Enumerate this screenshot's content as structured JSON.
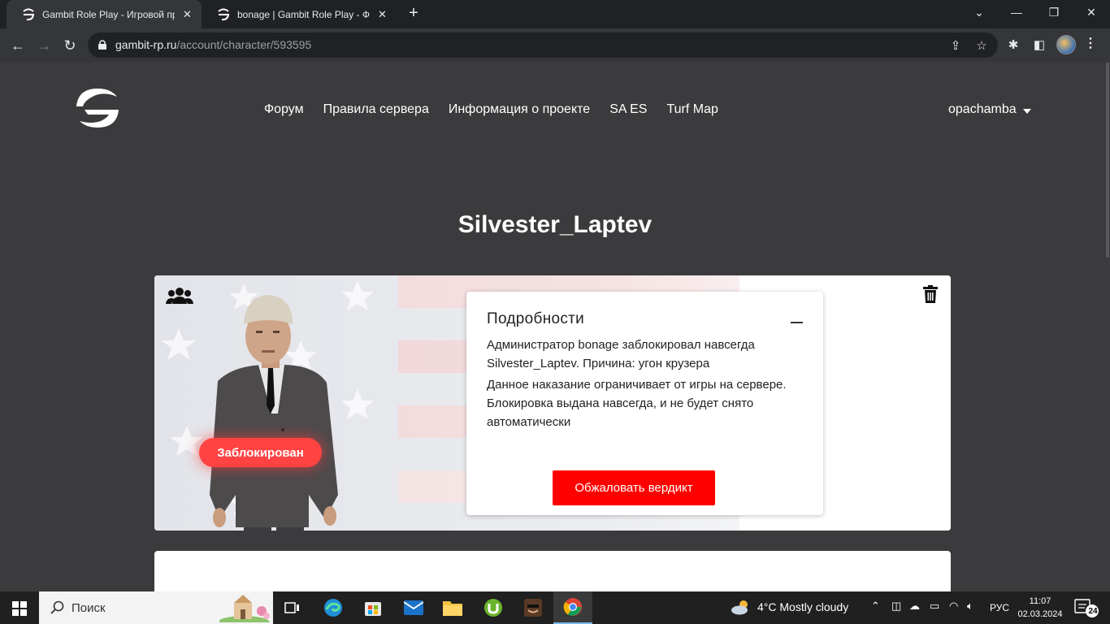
{
  "browser": {
    "tabs": [
      {
        "title": "Gambit Role Play - Игровой про",
        "active": true
      },
      {
        "title": "bonage | Gambit Role Play - Фор",
        "active": false
      }
    ],
    "url_host": "gambit-rp.ru",
    "url_path": "/account/character/593595"
  },
  "site": {
    "nav": [
      "Форум",
      "Правила сервера",
      "Информация о проекте",
      "SA ES",
      "Turf Map"
    ],
    "username": "opachamba"
  },
  "character": {
    "name": "Silvester_Laptev",
    "status_badge": "Заблокирован"
  },
  "details": {
    "title": "Подробности",
    "text1": "Администратор bonage заблокировал навсегда Silvester_Laptev. Причина: угон крузера",
    "text2": "Данное наказание ограничивает от игры на сервере. Блокировка выдана навсегда, и не будет снято автоматически",
    "appeal_button": "Обжаловать вердикт"
  },
  "taskbar": {
    "search_placeholder": "Поиск",
    "weather": "4°C  Mostly cloudy",
    "language": "РУС",
    "time": "11:07",
    "date": "02.03.2024",
    "notifications": "24"
  },
  "colors": {
    "page_bg": "#3b3b3d",
    "accent_red": "#ff0000",
    "badge_red": "#ff4343"
  }
}
